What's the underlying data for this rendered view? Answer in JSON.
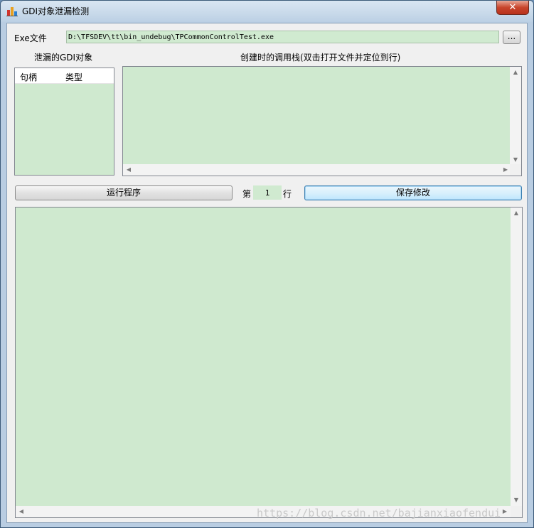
{
  "window": {
    "title": "GDI对象泄漏检测",
    "close_symbol": "✕"
  },
  "exe": {
    "label": "Exe文件",
    "path": "D:\\TFSDEV\\tt\\bin_undebug\\TPCommonControlTest.exe",
    "browse_label": "..."
  },
  "leaked": {
    "label": "泄漏的GDI对象",
    "columns": [
      "句柄",
      "类型"
    ]
  },
  "callstack": {
    "label": "创建时的调用栈(双击打开文件并定位到行)"
  },
  "toolbar": {
    "run_label": "运行程序",
    "line_prefix": "第",
    "line_value": "1",
    "line_suffix": "行",
    "save_label": "保存修改"
  },
  "watermark": "https://blog.csdn.net/bajianxiaofendui",
  "colors": {
    "panel_green": "#cfe9cf",
    "accent_blue": "#3c7fb1"
  }
}
